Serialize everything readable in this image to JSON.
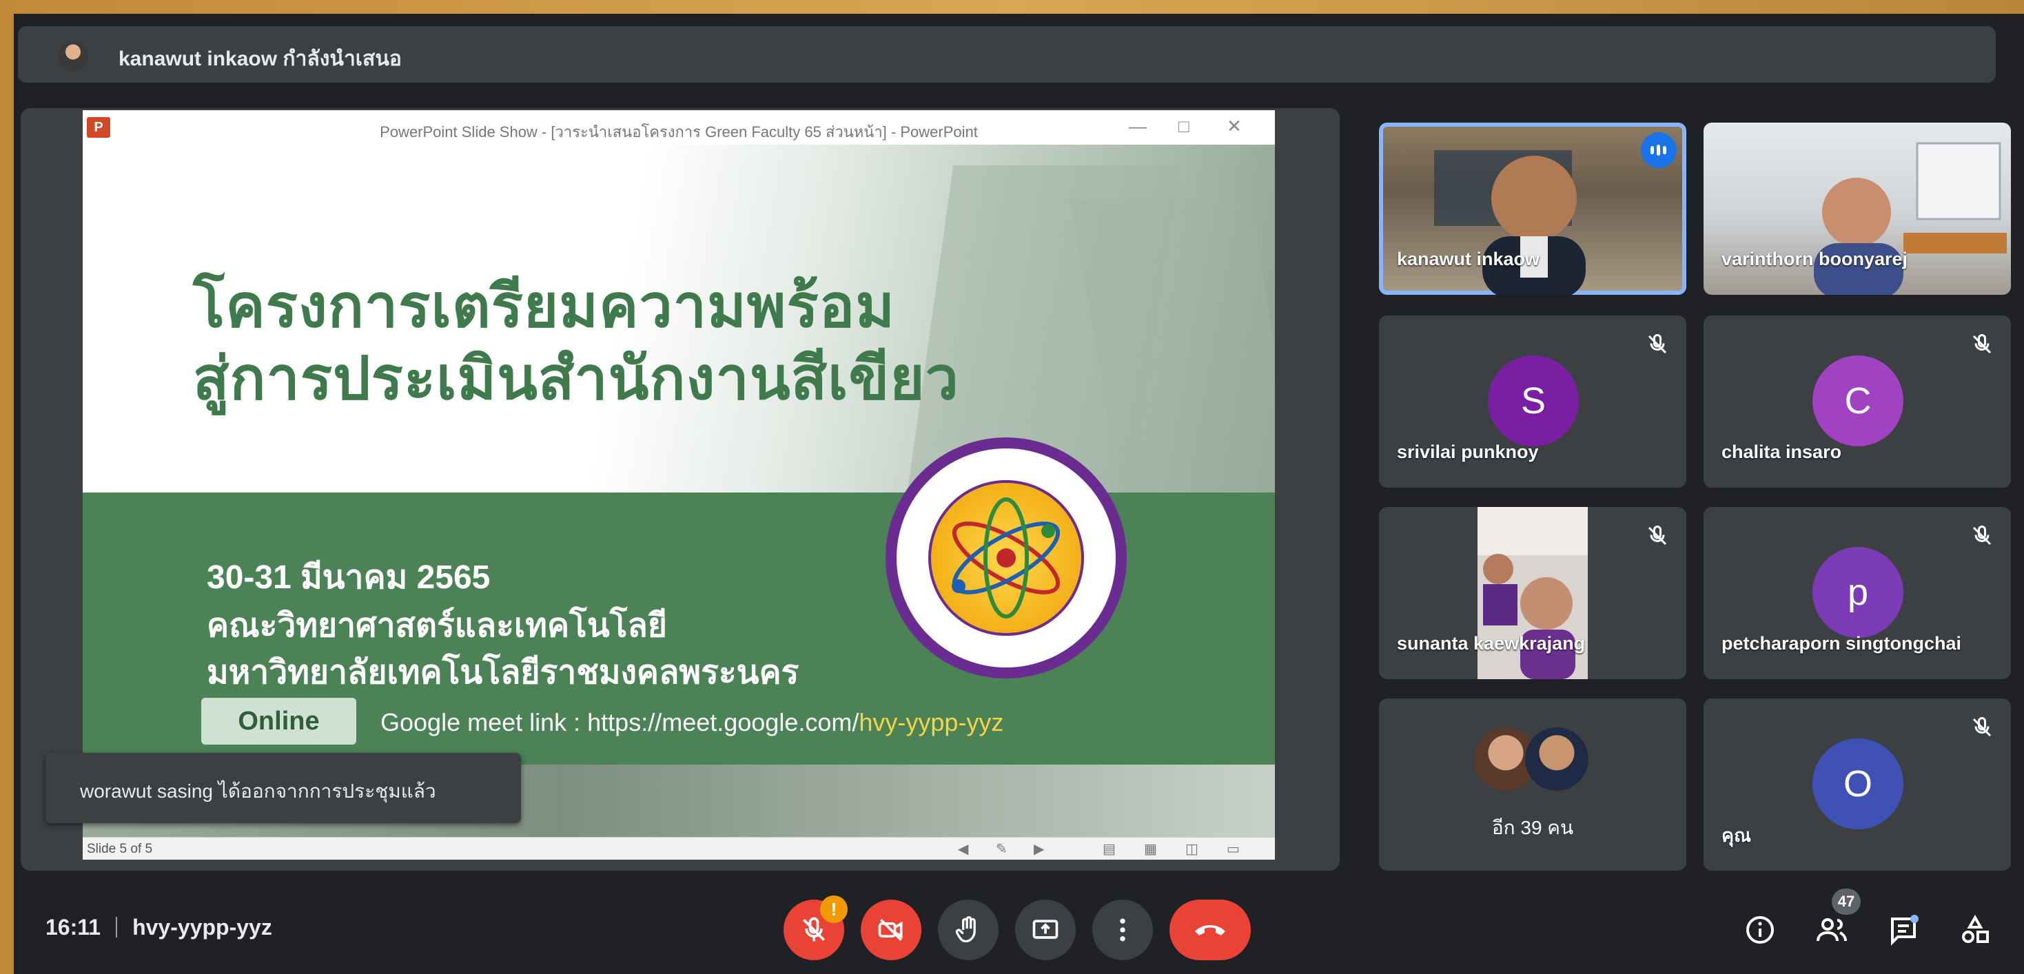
{
  "header": {
    "presenting_text": "kanawut inkaow กำลังนำเสนอ"
  },
  "presentation": {
    "window_title": "PowerPoint Slide Show - [วาระนำเสนอโครงการ Green Faculty 65 ส่วนหน้า] - PowerPoint",
    "app_icon_letter": "P",
    "heading_line1": "โครงการเตรียมความพร้อม",
    "heading_line2": "สู่การประเมินสำนักงานสีเขียว",
    "date": "30-31 มีนาคม 2565",
    "faculty": "คณะวิทยาศาสตร์และเทคโนโลยี",
    "university": "มหาวิทยาลัยเทคโนโลยีราชมงคลพระนคร",
    "online_label": "Online",
    "meet_link_prefix": "Google meet link : https://meet.google.com/",
    "meet_link_code": "hvy-yypp-yyz",
    "slide_counter": "Slide 5 of 5"
  },
  "toast": {
    "message": "worawut sasing ได้ออกจากการประชุมแล้ว"
  },
  "participants": [
    {
      "name": "kanawut inkaow",
      "type": "video",
      "speaking": true
    },
    {
      "name": "varinthorn boonyarej",
      "type": "video",
      "speaking": false
    },
    {
      "name": "srivilai punknoy",
      "initial": "S",
      "color": "#7b1fa2",
      "muted": true
    },
    {
      "name": "chalita insaro",
      "initial": "C",
      "color": "#a142c2",
      "muted": true
    },
    {
      "name": "sunanta kaewkrajang",
      "type": "video",
      "muted": true
    },
    {
      "name": "petcharaporn singtongchai",
      "initial": "p",
      "color": "#7b3bb6",
      "muted": true
    },
    {
      "name": "อีก 39 คน",
      "type": "others"
    },
    {
      "name": "คุณ",
      "initial": "O",
      "color": "#3f51b5",
      "muted": true
    }
  ],
  "bottom": {
    "time": "16:11",
    "meeting_code": "hvy-yypp-yyz",
    "warning_badge": "!",
    "people_count": "47"
  }
}
